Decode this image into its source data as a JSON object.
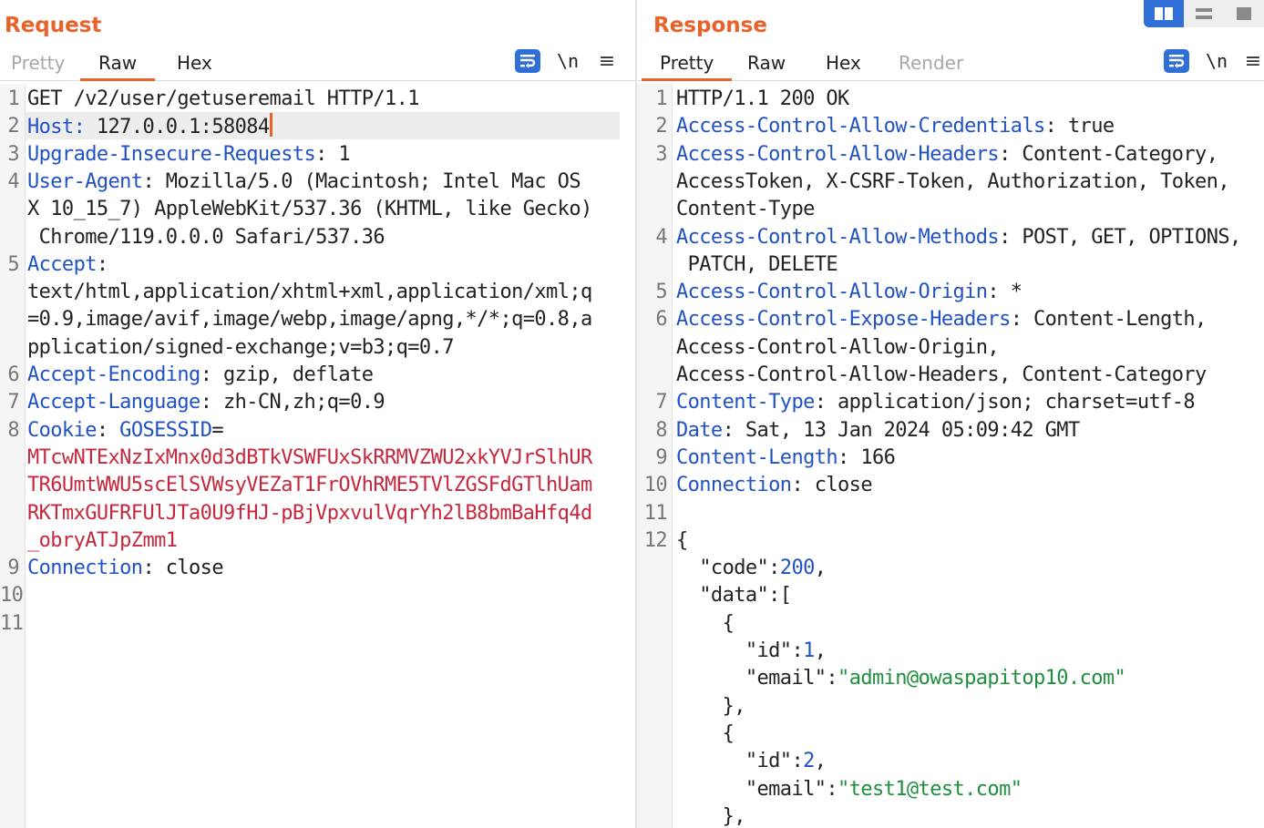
{
  "request": {
    "title": "Request",
    "tabs": [
      "Pretty",
      "Raw",
      "Hex"
    ],
    "active_tab": "Raw",
    "newline_toggle": "\\n",
    "lines": [
      {
        "n": "1",
        "segments": [
          {
            "t": "GET /v2/user/getuseremail HTTP/1.1",
            "c": ""
          }
        ]
      },
      {
        "n": "2",
        "segments": [
          {
            "t": "Host:",
            "c": "k"
          },
          {
            "t": " 127.0.0.1:58084",
            "c": ""
          }
        ],
        "caret": true
      },
      {
        "n": "3",
        "segments": [
          {
            "t": "Upgrade-Insecure-Requests",
            "c": "k"
          },
          {
            "t": ": 1",
            "c": ""
          }
        ]
      },
      {
        "n": "4",
        "segments": [
          {
            "t": "User-Agent",
            "c": "k"
          },
          {
            "t": ": Mozilla/5.0 (Macintosh; Intel Mac OS",
            "c": ""
          }
        ]
      },
      {
        "n": "",
        "segments": [
          {
            "t": "X 10_15_7) AppleWebKit/537.36 (KHTML, like Gecko)",
            "c": ""
          }
        ]
      },
      {
        "n": "",
        "segments": [
          {
            "t": " Chrome/119.0.0.0 Safari/537.36",
            "c": ""
          }
        ]
      },
      {
        "n": "5",
        "segments": [
          {
            "t": "Accept",
            "c": "k"
          },
          {
            "t": ":",
            "c": ""
          }
        ]
      },
      {
        "n": "",
        "segments": [
          {
            "t": "text/html,application/xhtml+xml,application/xml;q",
            "c": ""
          }
        ]
      },
      {
        "n": "",
        "segments": [
          {
            "t": "=0.9,image/avif,image/webp,image/apng,*/*;q=0.8,a",
            "c": ""
          }
        ]
      },
      {
        "n": "",
        "segments": [
          {
            "t": "pplication/signed-exchange;v=b3;q=0.7",
            "c": ""
          }
        ]
      },
      {
        "n": "6",
        "segments": [
          {
            "t": "Accept-Encoding",
            "c": "k"
          },
          {
            "t": ": gzip, deflate",
            "c": ""
          }
        ]
      },
      {
        "n": "7",
        "segments": [
          {
            "t": "Accept-Language",
            "c": "k"
          },
          {
            "t": ": zh-CN,zh;q=0.9",
            "c": ""
          }
        ]
      },
      {
        "n": "8",
        "segments": [
          {
            "t": "Cookie",
            "c": "k"
          },
          {
            "t": ": ",
            "c": ""
          },
          {
            "t": "GOSESSID",
            "c": "k"
          },
          {
            "t": "=",
            "c": ""
          }
        ]
      },
      {
        "n": "",
        "segments": [
          {
            "t": "MTcwNTExNzIxMnx0d3dBTkVSWFUxSkRRMVZWU2xkYVJrSlhUR",
            "c": "red"
          }
        ]
      },
      {
        "n": "",
        "segments": [
          {
            "t": "TR6UmtWWU5scElSVWsyVEZaT1FrOVhRME5TVlZGSFdGTlhUam",
            "c": "red"
          }
        ]
      },
      {
        "n": "",
        "segments": [
          {
            "t": "RKTmxGUFRFUlJTa0U9fHJ-pBjVpxvulVqrYh2lB8bmBaHfq4d",
            "c": "red"
          }
        ]
      },
      {
        "n": "",
        "segments": [
          {
            "t": "_obryATJpZmm1",
            "c": "red"
          }
        ]
      },
      {
        "n": "9",
        "segments": [
          {
            "t": "Connection",
            "c": "k"
          },
          {
            "t": ": close",
            "c": ""
          }
        ]
      },
      {
        "n": "10",
        "segments": []
      },
      {
        "n": "11",
        "segments": []
      }
    ]
  },
  "response": {
    "title": "Response",
    "tabs": [
      "Pretty",
      "Raw",
      "Hex",
      "Render"
    ],
    "active_tab": "Pretty",
    "newline_toggle": "\\n",
    "lines": [
      {
        "n": "1",
        "segments": [
          {
            "t": "HTTP/1.1 200 OK",
            "c": ""
          }
        ]
      },
      {
        "n": "2",
        "segments": [
          {
            "t": "Access-Control-Allow-Credentials",
            "c": "k"
          },
          {
            "t": ": true",
            "c": ""
          }
        ]
      },
      {
        "n": "3",
        "segments": [
          {
            "t": "Access-Control-Allow-Headers",
            "c": "k"
          },
          {
            "t": ": Content-Category,",
            "c": ""
          }
        ]
      },
      {
        "n": "",
        "segments": [
          {
            "t": "AccessToken, X-CSRF-Token, Authorization, Token,",
            "c": ""
          }
        ]
      },
      {
        "n": "",
        "segments": [
          {
            "t": "Content-Type",
            "c": ""
          }
        ]
      },
      {
        "n": "4",
        "segments": [
          {
            "t": "Access-Control-Allow-Methods",
            "c": "k"
          },
          {
            "t": ": POST, GET, OPTIONS,",
            "c": ""
          }
        ]
      },
      {
        "n": "",
        "segments": [
          {
            "t": " PATCH, DELETE",
            "c": ""
          }
        ]
      },
      {
        "n": "5",
        "segments": [
          {
            "t": "Access-Control-Allow-Origin",
            "c": "k"
          },
          {
            "t": ": *",
            "c": ""
          }
        ]
      },
      {
        "n": "6",
        "segments": [
          {
            "t": "Access-Control-Expose-Headers",
            "c": "k"
          },
          {
            "t": ": Content-Length,",
            "c": ""
          }
        ]
      },
      {
        "n": "",
        "segments": [
          {
            "t": "Access-Control-Allow-Origin,",
            "c": ""
          }
        ]
      },
      {
        "n": "",
        "segments": [
          {
            "t": "Access-Control-Allow-Headers, Content-Category",
            "c": ""
          }
        ]
      },
      {
        "n": "7",
        "segments": [
          {
            "t": "Content-Type",
            "c": "k"
          },
          {
            "t": ": application/json; charset=utf-8",
            "c": ""
          }
        ]
      },
      {
        "n": "8",
        "segments": [
          {
            "t": "Date",
            "c": "k"
          },
          {
            "t": ": Sat, 13 Jan 2024 05:09:42 GMT",
            "c": ""
          }
        ]
      },
      {
        "n": "9",
        "segments": [
          {
            "t": "Content-Length",
            "c": "k"
          },
          {
            "t": ": 166",
            "c": ""
          }
        ]
      },
      {
        "n": "10",
        "segments": [
          {
            "t": "Connection",
            "c": "k"
          },
          {
            "t": ": close",
            "c": ""
          }
        ]
      },
      {
        "n": "11",
        "segments": []
      },
      {
        "n": "12",
        "segments": [
          {
            "t": "{",
            "c": ""
          }
        ]
      },
      {
        "n": "",
        "segments": [
          {
            "t": "  \"code\":",
            "c": ""
          },
          {
            "t": "200",
            "c": "num"
          },
          {
            "t": ",",
            "c": ""
          }
        ]
      },
      {
        "n": "",
        "segments": [
          {
            "t": "  \"data\":[",
            "c": ""
          }
        ]
      },
      {
        "n": "",
        "segments": [
          {
            "t": "    {",
            "c": ""
          }
        ]
      },
      {
        "n": "",
        "segments": [
          {
            "t": "      \"id\":",
            "c": ""
          },
          {
            "t": "1",
            "c": "num"
          },
          {
            "t": ",",
            "c": ""
          }
        ]
      },
      {
        "n": "",
        "segments": [
          {
            "t": "      \"email\":",
            "c": ""
          },
          {
            "t": "\"admin@owaspapitop10.com\"",
            "c": "str"
          }
        ]
      },
      {
        "n": "",
        "segments": [
          {
            "t": "    },",
            "c": ""
          }
        ]
      },
      {
        "n": "",
        "segments": [
          {
            "t": "    {",
            "c": ""
          }
        ]
      },
      {
        "n": "",
        "segments": [
          {
            "t": "      \"id\":",
            "c": ""
          },
          {
            "t": "2",
            "c": "num"
          },
          {
            "t": ",",
            "c": ""
          }
        ]
      },
      {
        "n": "",
        "segments": [
          {
            "t": "      \"email\":",
            "c": ""
          },
          {
            "t": "\"test1@test.com\"",
            "c": "str"
          }
        ]
      },
      {
        "n": "",
        "segments": [
          {
            "t": "    },",
            "c": ""
          }
        ]
      }
    ]
  },
  "icons": {
    "pretty_wrap": "wrap-lines-icon",
    "menu": "hamburger-menu-icon",
    "layout_split": "split-columns-icon",
    "layout_rows": "rows-layout-icon",
    "layout_single": "single-pane-icon"
  },
  "colors": {
    "accent": "#e8622c",
    "header_key": "#2152c4",
    "cookie_value": "#c5283d",
    "json_string": "#1f8f3e",
    "toggle_blue": "#2f6fd6"
  }
}
